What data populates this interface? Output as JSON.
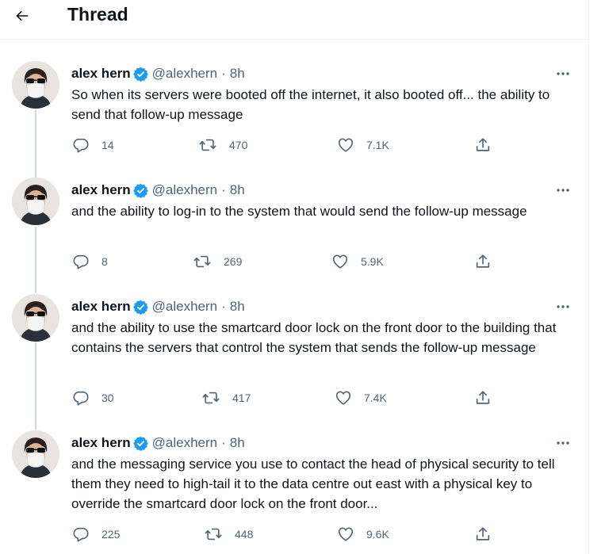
{
  "header": {
    "title": "Thread"
  },
  "tweets": [
    {
      "name": "alex hern",
      "handle": "@alexhern",
      "separator": "·",
      "time": "8h",
      "text": "So when its servers were booted off the internet, it also booted off... the ability to send that follow-up message",
      "replies": "14",
      "retweets": "470",
      "likes": "7.1K"
    },
    {
      "name": "alex hern",
      "handle": "@alexhern",
      "separator": "·",
      "time": "8h",
      "text": "and the ability to log-in to the system that would send the follow-up message",
      "replies": "8",
      "retweets": "269",
      "likes": "5.9K"
    },
    {
      "name": "alex hern",
      "handle": "@alexhern",
      "separator": "·",
      "time": "8h",
      "text": "and the ability to use the smartcard door lock on the front door to the building that contains the servers that control the system that sends the follow-up message",
      "replies": "30",
      "retweets": "417",
      "likes": "7.4K"
    },
    {
      "name": "alex hern",
      "handle": "@alexhern",
      "separator": "·",
      "time": "8h",
      "text": "and the messaging service you use to contact the head of physical security to tell them they need to high-tail it to the data centre out east with a physical key to override the smartcard door lock on the front door...",
      "replies": "225",
      "retweets": "448",
      "likes": "9.6K"
    }
  ],
  "icons": {
    "back": "arrow-left-icon",
    "verified": "verified-badge-icon",
    "more": "more-dots-icon",
    "reply": "reply-icon",
    "retweet": "retweet-icon",
    "like": "heart-icon",
    "share": "share-icon"
  },
  "colors": {
    "text": "#0f1419",
    "secondary": "#536471",
    "verified": "#1d9bf0",
    "divider": "#eff3f4",
    "thread_line": "#cfd9de"
  }
}
